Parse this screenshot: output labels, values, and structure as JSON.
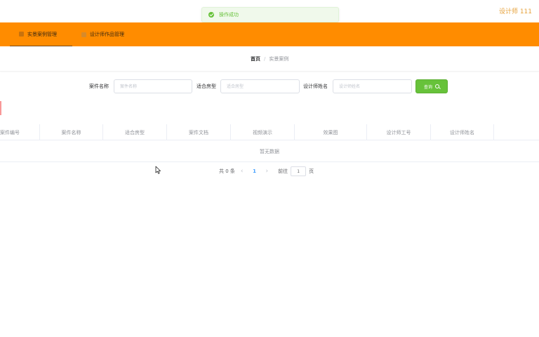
{
  "header": {
    "user_name": "设计师 111"
  },
  "toast": {
    "message": "操作成功",
    "type": "success"
  },
  "nav": {
    "items": [
      {
        "label": "实景案例管理",
        "active": true
      },
      {
        "label": "设计师作品管理",
        "active": false
      }
    ]
  },
  "breadcrumb": {
    "home": "首页",
    "separator": "/",
    "current": "实景案例"
  },
  "search": {
    "case_name_label": "案件名称",
    "case_name_placeholder": "案件名称",
    "room_type_label": "适合房型",
    "room_type_placeholder": "适合房型",
    "designer_name_label": "设计师姓名",
    "designer_name_placeholder": "设计师姓名",
    "button_label": "查询"
  },
  "table": {
    "columns": [
      "案件编号",
      "案件名称",
      "适合房型",
      "案件文档",
      "视频演示",
      "效果图",
      "设计师工号",
      "设计师姓名"
    ],
    "empty_text": "暂无数据"
  },
  "pagination": {
    "total_text": "共 0 条",
    "current_page": "1",
    "goto_label": "前往",
    "goto_value": "1",
    "page_suffix": "页"
  },
  "colors": {
    "nav_background": "#ff8c00",
    "success": "#67c23a",
    "user_name": "#e6a23c",
    "page_link": "#409eff"
  },
  "icons": {
    "toast": "check-circle-icon",
    "search": "search-icon",
    "prev": "chevron-left-icon",
    "next": "chevron-right-icon"
  }
}
